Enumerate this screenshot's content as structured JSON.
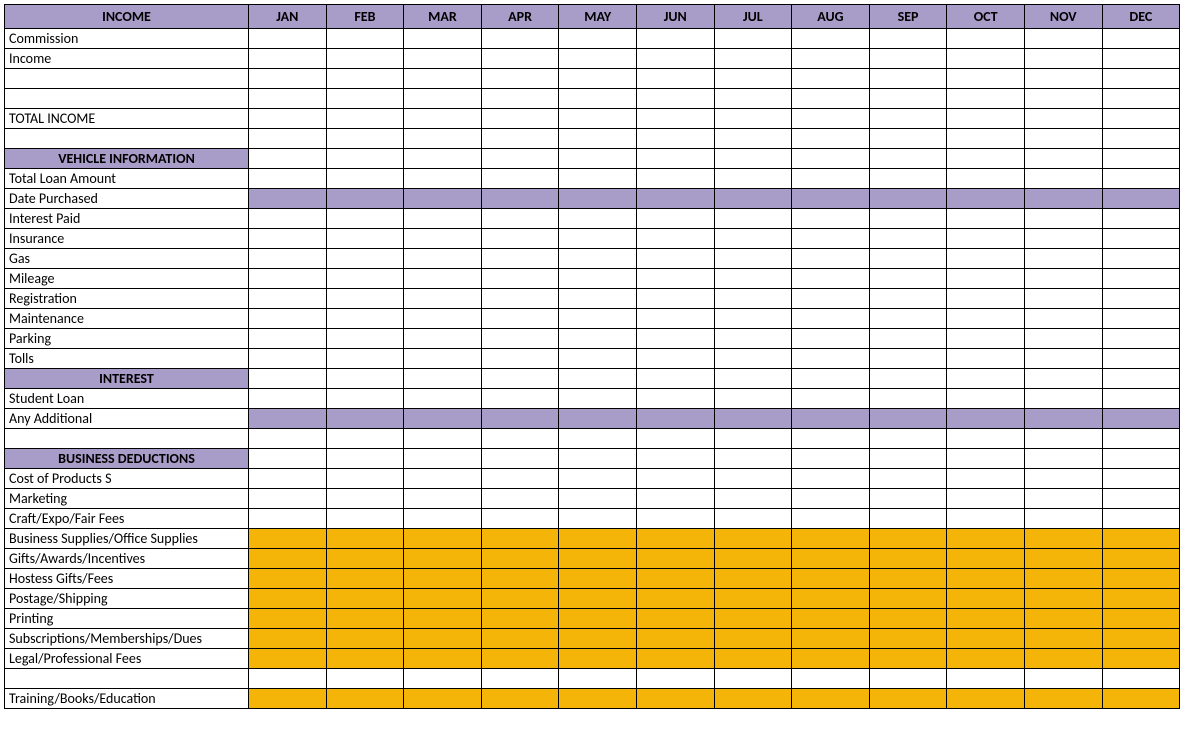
{
  "headers": {
    "first": "INCOME",
    "months": [
      "JAN",
      "FEB",
      "MAR",
      "APR",
      "MAY",
      "JUN",
      "JUL",
      "AUG",
      "SEP",
      "OCT",
      "NOV",
      "DEC"
    ]
  },
  "rows": [
    {
      "label": "Commission",
      "type": "data",
      "fill": ""
    },
    {
      "label": "Income",
      "type": "data",
      "fill": ""
    },
    {
      "label": "",
      "type": "data",
      "fill": ""
    },
    {
      "label": "",
      "type": "data",
      "fill": ""
    },
    {
      "label": "TOTAL INCOME",
      "type": "data",
      "fill": ""
    },
    {
      "label": "",
      "type": "data",
      "fill": ""
    },
    {
      "label": "VEHICLE INFORMATION",
      "type": "section",
      "fill": ""
    },
    {
      "label": "Total Loan Amount",
      "type": "data",
      "fill": ""
    },
    {
      "label": "Date Purchased",
      "type": "data",
      "fill": "purple"
    },
    {
      "label": "Interest Paid",
      "type": "data",
      "fill": ""
    },
    {
      "label": "Insurance",
      "type": "data",
      "fill": ""
    },
    {
      "label": "Gas",
      "type": "data",
      "fill": ""
    },
    {
      "label": "Mileage",
      "type": "data",
      "fill": ""
    },
    {
      "label": "Registration",
      "type": "data",
      "fill": ""
    },
    {
      "label": "Maintenance",
      "type": "data",
      "fill": ""
    },
    {
      "label": "Parking",
      "type": "data",
      "fill": ""
    },
    {
      "label": "Tolls",
      "type": "data",
      "fill": ""
    },
    {
      "label": "INTEREST",
      "type": "section",
      "fill": ""
    },
    {
      "label": "Student Loan",
      "type": "data",
      "fill": ""
    },
    {
      "label": "Any Additional",
      "type": "data",
      "fill": "purple"
    },
    {
      "label": "",
      "type": "data",
      "fill": ""
    },
    {
      "label": "BUSINESS DEDUCTIONS",
      "type": "section",
      "fill": ""
    },
    {
      "label": "Cost of Products S",
      "type": "data",
      "fill": ""
    },
    {
      "label": "Marketing",
      "type": "data",
      "fill": ""
    },
    {
      "label": "Craft/Expo/Fair Fees",
      "type": "data",
      "fill": ""
    },
    {
      "label": "Business Supplies/Office Supplies",
      "type": "data",
      "fill": "orange"
    },
    {
      "label": "Gifts/Awards/Incentives",
      "type": "data",
      "fill": "orange"
    },
    {
      "label": "Hostess Gifts/Fees",
      "type": "data",
      "fill": "orange"
    },
    {
      "label": "Postage/Shipping",
      "type": "data",
      "fill": "orange"
    },
    {
      "label": "Printing",
      "type": "data",
      "fill": "orange"
    },
    {
      "label": "Subscriptions/Memberships/Dues",
      "type": "data",
      "fill": "orange"
    },
    {
      "label": "Legal/Professional Fees",
      "type": "data",
      "fill": "orange"
    },
    {
      "label": "",
      "type": "data",
      "fill": ""
    },
    {
      "label": "Training/Books/Education",
      "type": "data",
      "fill": "orange"
    }
  ]
}
